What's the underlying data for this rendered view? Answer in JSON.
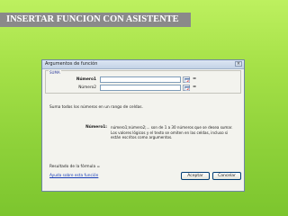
{
  "slide": {
    "title": "INSERTAR FUNCION CON ASISTENTE"
  },
  "dialog": {
    "title": "Argumentos de función",
    "close_label": "×",
    "function_name": "SUMA",
    "arguments": [
      {
        "label": "Número1",
        "value": "",
        "result": ""
      },
      {
        "label": "Número2",
        "value": "",
        "result": ""
      }
    ],
    "equals": "=",
    "description": "Suma todos los números en un rango de celdas.",
    "help_arg_name": "Número1:",
    "help_arg_text": "número1;número2;... son de 1 a 30 números que se desea sumar. Los valores lógicos y el texto se omiten en las celdas, incluso si están escritos como argumentos.",
    "result_label": "Resultado de la fórmula =",
    "help_link": "Ayuda sobre esta función",
    "ok_label": "Aceptar",
    "cancel_label": "Cancelar"
  }
}
